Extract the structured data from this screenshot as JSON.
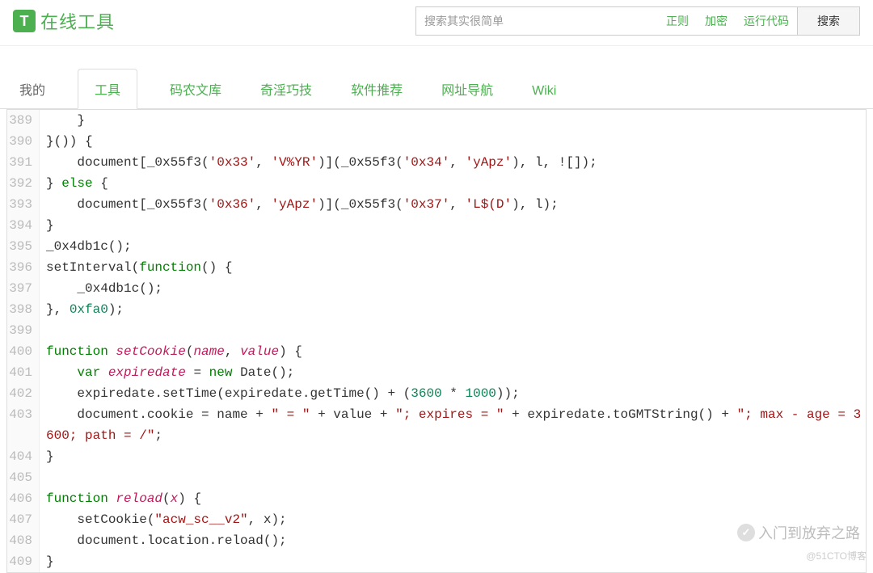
{
  "header": {
    "logo_letter": "T",
    "logo_text": "在线工具",
    "search_placeholder": "搜索其实很简单",
    "pills": [
      "正则",
      "加密",
      "运行代码"
    ],
    "search_button": "搜索"
  },
  "tabs": [
    {
      "label": "我的",
      "active": false
    },
    {
      "label": "工具",
      "active": true
    },
    {
      "label": "码农文库",
      "active": false
    },
    {
      "label": "奇淫巧技",
      "active": false
    },
    {
      "label": "软件推荐",
      "active": false
    },
    {
      "label": "网址导航",
      "active": false
    },
    {
      "label": "Wiki",
      "active": false
    }
  ],
  "code": {
    "lines": [
      {
        "n": 389,
        "html": "    }"
      },
      {
        "n": 390,
        "html": "}()) {"
      },
      {
        "n": 391,
        "html": "    document[_0x55f3(<span class='str'>'0x33'</span>, <span class='str'>'V%YR'</span>)](_0x55f3(<span class='str'>'0x34'</span>, <span class='str'>'yApz'</span>), l, ![]);"
      },
      {
        "n": 392,
        "html": "} <span class='kw'>else</span> {"
      },
      {
        "n": 393,
        "html": "    document[_0x55f3(<span class='str'>'0x36'</span>, <span class='str'>'yApz'</span>)](_0x55f3(<span class='str'>'0x37'</span>, <span class='str'>'L$(D'</span>), l);"
      },
      {
        "n": 394,
        "html": "}"
      },
      {
        "n": 395,
        "html": "_0x4db1c();"
      },
      {
        "n": 396,
        "html": "setInterval(<span class='kw'>function</span>() {"
      },
      {
        "n": 397,
        "html": "    _0x4db1c();"
      },
      {
        "n": 398,
        "html": "}, <span class='num'>0xfa0</span>);"
      },
      {
        "n": 399,
        "html": ""
      },
      {
        "n": 400,
        "html": "<span class='kw'>function</span> <span class='fn'>setCookie</span>(<span class='param'>name</span>, <span class='param'>value</span>) {"
      },
      {
        "n": 401,
        "html": "    <span class='kw'>var</span> <span class='param'>expiredate</span> = <span class='kw'>new</span> Date();"
      },
      {
        "n": 402,
        "html": "    expiredate.setTime(expiredate.getTime() + (<span class='num'>3600</span> * <span class='num'>1000</span>));"
      },
      {
        "n": 403,
        "html": "    document.cookie = name + <span class='str'>\" = \"</span> + value + <span class='str'>\"; expires = \"</span> + expiredate.toGMTString() + <span class='str'>\"; max - age = 3600; path = /\"</span>;"
      },
      {
        "n": 404,
        "html": "}"
      },
      {
        "n": 405,
        "html": ""
      },
      {
        "n": 406,
        "html": "<span class='kw'>function</span> <span class='fn'>reload</span>(<span class='param'>x</span>) {"
      },
      {
        "n": 407,
        "html": "    setCookie(<span class='str'>\"acw_sc__v2\"</span>, x);"
      },
      {
        "n": 408,
        "html": "    document.location.reload();"
      },
      {
        "n": 409,
        "html": "}"
      }
    ]
  },
  "watermark": {
    "text": "入门到放弃之路"
  },
  "attribution": "@51CTO博客"
}
